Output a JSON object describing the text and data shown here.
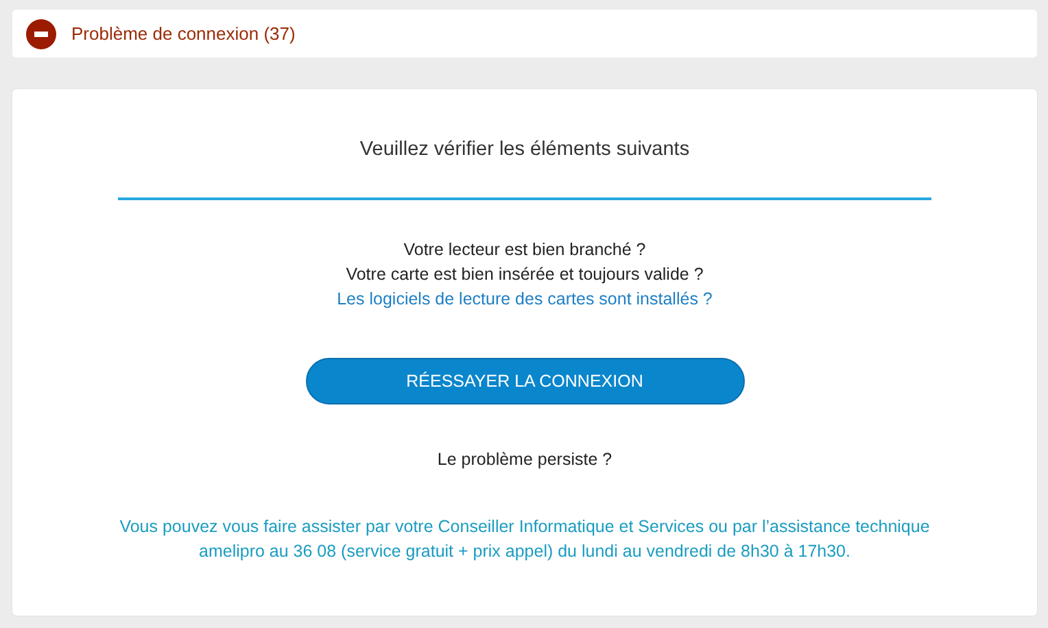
{
  "alert": {
    "title": "Problème de connexion (37)"
  },
  "panel": {
    "heading": "Veuillez vérifier les éléments suivants",
    "checks": [
      {
        "kind": "question",
        "text": "Votre lecteur est bien branché ?"
      },
      {
        "kind": "question",
        "text": "Votre carte est bien insérée et toujours valide ?"
      },
      {
        "kind": "link",
        "text": "Les logiciels de lecture des cartes sont installés ?"
      }
    ],
    "retry_button": "RÉESSAYER LA CONNEXION",
    "persist_text": "Le problème persiste ?",
    "help_text": "Vous pouvez vous faire assister par votre Conseiller Informatique et Services ou par l’assistance technique amelipro au 36 08 (service gratuit + prix appel) du lundi au vendredi de 8h30 à 17h30."
  }
}
